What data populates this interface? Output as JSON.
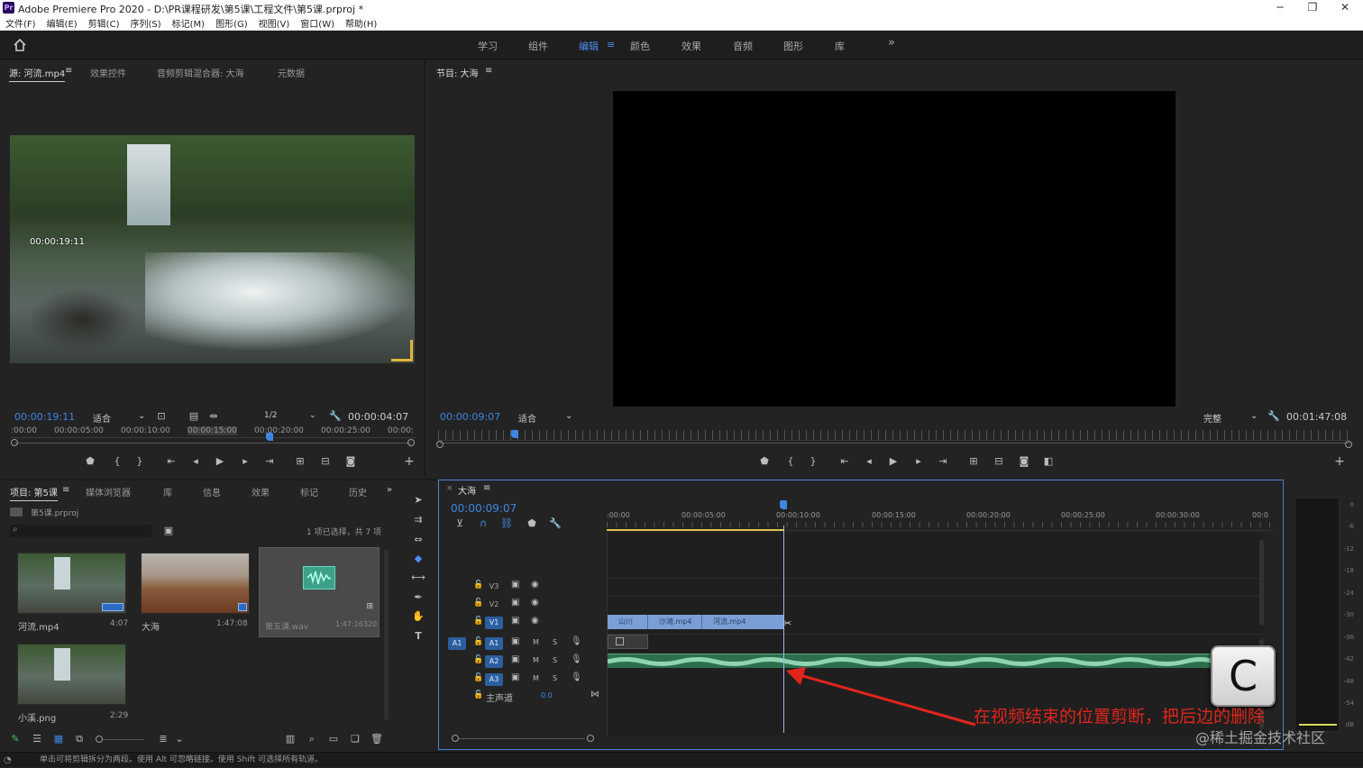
{
  "window": {
    "title": "Adobe Premiere Pro 2020 - D:\\PR课程研发\\第5课\\工程文件\\第5课.prproj *",
    "logo": "Pr",
    "controls": [
      "─",
      "❐",
      "✕"
    ]
  },
  "menu": [
    "文件(F)",
    "编辑(E)",
    "剪辑(C)",
    "序列(S)",
    "标记(M)",
    "图形(G)",
    "视图(V)",
    "窗口(W)",
    "帮助(H)"
  ],
  "workspaces": {
    "items": [
      "学习",
      "组件",
      "编辑",
      "颜色",
      "效果",
      "音频",
      "图形",
      "库"
    ],
    "active": "编辑",
    "more": "»"
  },
  "source": {
    "tabs": [
      "源: 河流.mp4",
      "效果控件",
      "音频剪辑混合器: 大海",
      "元数据"
    ],
    "overlay_tc": "00:00:19:11",
    "current_tc": "00:00:19:11",
    "fit": "适合",
    "resolution": "1/2",
    "duration": "00:00:04:07",
    "ruler_labels": [
      ":00:00",
      "00:00:05:00",
      "00:00:10:00",
      "00:00:15:00",
      "00:00:20:00",
      "00:00:25:00",
      "00:00:"
    ]
  },
  "program": {
    "tab": "节目: 大海",
    "current_tc": "00:00:09:07",
    "fit": "适合",
    "quality": "完整",
    "duration": "00:01:47:08"
  },
  "project": {
    "tabs": [
      "项目: 第5课",
      "媒体浏览器",
      "库",
      "信息",
      "效果",
      "标记",
      "历史"
    ],
    "file": "第5课.prproj",
    "selection_info": "1 项已选择，共 7 项",
    "items": [
      {
        "name": "河流.mp4",
        "duration": "4:07"
      },
      {
        "name": "大海",
        "duration": "1:47:08"
      },
      {
        "name": "第五课.wav",
        "duration": "1:47:16320"
      },
      {
        "name": "小溪.png",
        "duration": "2:29"
      }
    ]
  },
  "timeline": {
    "tab": "大海",
    "current_tc": "00:00:09:07",
    "ruler_labels": [
      ":00:00",
      "00:00:05:00",
      "00:00:10:00",
      "00:00:15:00",
      "00:00:20:00",
      "00:00:25:00",
      "00:00:30:00",
      "00:0"
    ],
    "tracks": {
      "video": [
        "V3",
        "V2",
        "V1"
      ],
      "audio": [
        "A1",
        "A2",
        "A3"
      ],
      "source_patch": "A1",
      "master": "主声道",
      "master_value": "0.0",
      "mute": "M",
      "solo": "S"
    },
    "clips": [
      "山川",
      "沙滩.mp4",
      "河流.mp4"
    ]
  },
  "overlay": {
    "key": "C",
    "annotation": "在视频结束的位置剪断，把后边的删除",
    "annotation_color": "#e0251b",
    "watermark": "@稀土掘金技术社区"
  },
  "meter_labels": [
    "0",
    "-6",
    "-12",
    "-18",
    "-24",
    "-30",
    "-36",
    "-42",
    "-48",
    "-54",
    "dB"
  ],
  "status": "单击可将剪辑拆分为两段。使用 Alt 可忽略链接。使用 Shift 可选择所有轨道。",
  "colors": {
    "accent": "#3d87e0",
    "clip_video": "#7a9fd6",
    "audio_clip": "#2d6f4c",
    "waveform": "#7dc2a4",
    "in_out_bar": "#e1c24a"
  }
}
